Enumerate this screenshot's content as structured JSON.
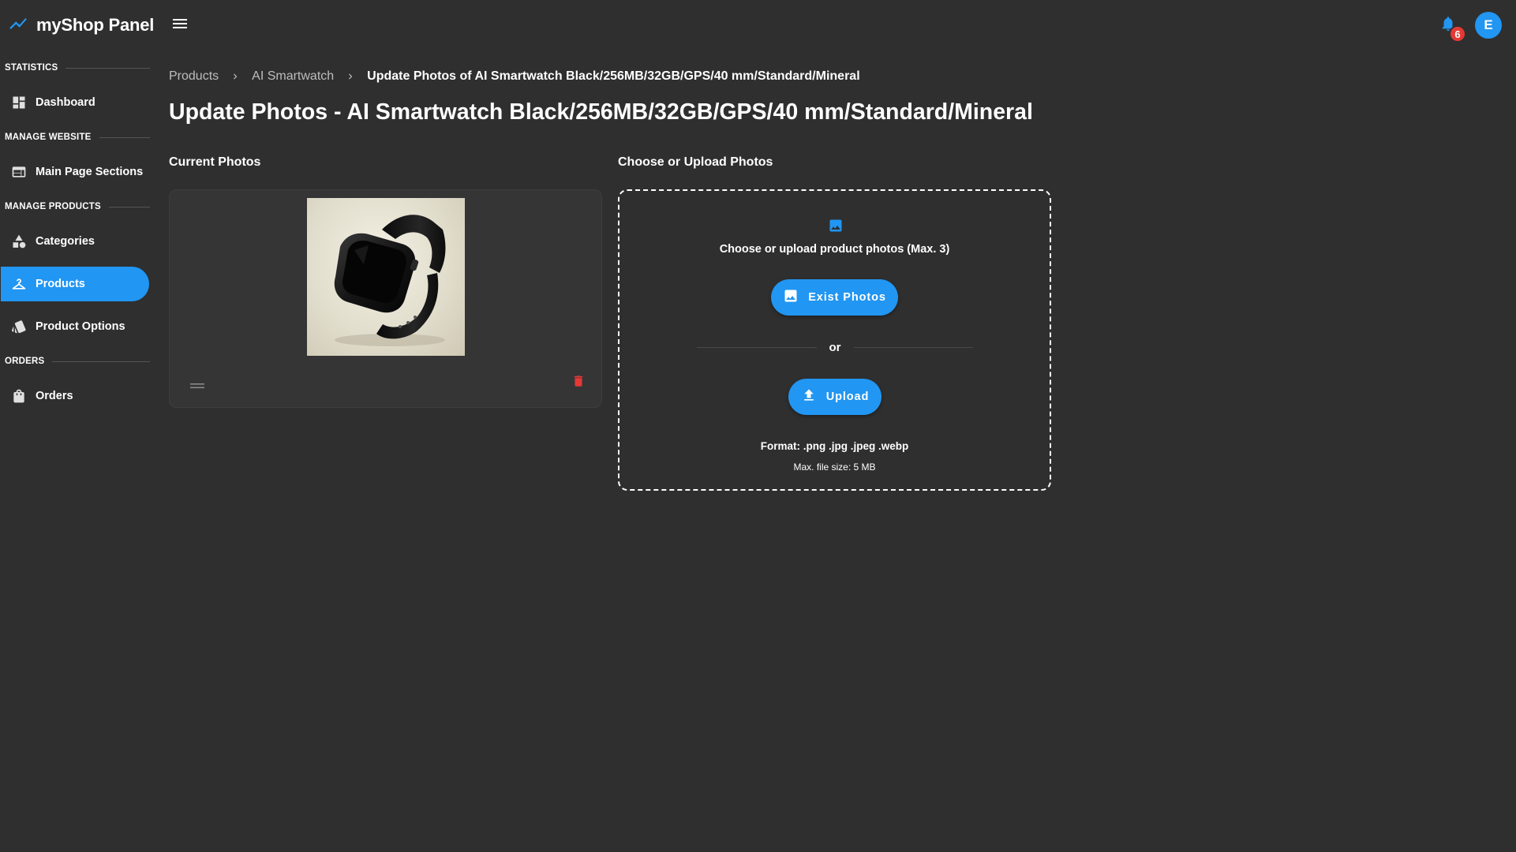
{
  "app": {
    "title": "myShop Panel",
    "brand_icon": "line-chart-icon",
    "accent_color": "#2196f3",
    "notification_count": "6",
    "avatar_initial": "E"
  },
  "sidebar": {
    "sections": [
      {
        "title": "STATISTICS",
        "items": [
          {
            "label": "Dashboard",
            "icon": "dashboard-icon"
          }
        ]
      },
      {
        "title": "MANAGE WEBSITE",
        "items": [
          {
            "label": "Main Page Sections",
            "icon": "web-sections-icon"
          }
        ]
      },
      {
        "title": "MANAGE PRODUCTS",
        "items": [
          {
            "label": "Categories",
            "icon": "category-icon"
          },
          {
            "label": "Products",
            "icon": "hanger-icon",
            "active": true
          },
          {
            "label": "Product Options",
            "icon": "style-icon"
          }
        ]
      },
      {
        "title": "ORDERS",
        "items": [
          {
            "label": "Orders",
            "icon": "shopping-bag-icon"
          }
        ]
      }
    ]
  },
  "breadcrumb": {
    "items": [
      "Products",
      "AI Smartwatch"
    ],
    "current": "Update Photos of AI Smartwatch Black/256MB/32GB/GPS/40 mm/Standard/Mineral"
  },
  "page": {
    "title": "Update Photos - AI Smartwatch Black/256MB/32GB/GPS/40 mm/Standard/Mineral"
  },
  "current_photos": {
    "title": "Current Photos",
    "photos": [
      {
        "alt": "AI Smartwatch",
        "icon": "smartwatch-photo"
      }
    ]
  },
  "upload": {
    "title": "Choose or Upload Photos",
    "hint": "Choose or upload product photos (Max. 3)",
    "exist_button": "Exist Photos",
    "or_label": "or",
    "upload_button": "Upload",
    "format": "Format: .png .jpg .jpeg .webp",
    "max_size": "Max. file size: 5 MB"
  },
  "colors": {
    "background": "#2f2f2f",
    "delete": "#e53935"
  }
}
